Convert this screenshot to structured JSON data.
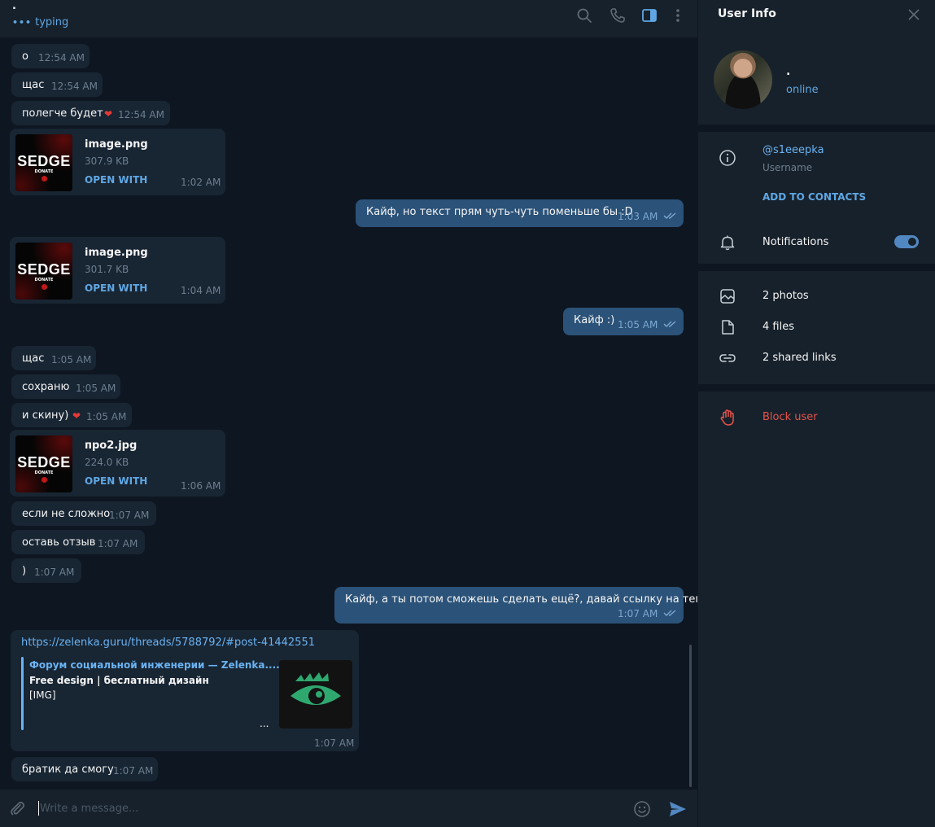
{
  "chat": {
    "peer_name": ".",
    "typing_text": "typing",
    "input_placeholder": "Write a message..."
  },
  "messages": [
    {
      "dir": "in",
      "text": "о",
      "time": "12:54 AM"
    },
    {
      "dir": "in",
      "text": "щас",
      "time": "12:54 AM"
    },
    {
      "dir": "in",
      "text": "полегче будет",
      "time": "12:54 AM",
      "reaction": "heart"
    },
    {
      "dir": "in",
      "type": "file",
      "thumb_brand": "SEDGE",
      "thumb_sub": "DONATE",
      "file_name": "image.png",
      "file_size": "307.9 KB",
      "action": "OPEN WITH",
      "time": "1:02 AM"
    },
    {
      "dir": "out",
      "text": "Кайф, но текст прям чуть-чуть поменьше бы :D",
      "time": "1:03 AM",
      "read": true
    },
    {
      "dir": "in",
      "type": "file",
      "thumb_brand": "SEDGE",
      "thumb_sub": "DONATE",
      "file_name": "image.png",
      "file_size": "301.7 KB",
      "action": "OPEN WITH",
      "time": "1:04 AM"
    },
    {
      "dir": "out",
      "text": "Кайф :)",
      "time": "1:05 AM",
      "read": true
    },
    {
      "dir": "in",
      "text": "щас",
      "time": "1:05 AM"
    },
    {
      "dir": "in",
      "text": "сохраню",
      "time": "1:05 AM"
    },
    {
      "dir": "in",
      "text": "и скину)",
      "time": "1:05 AM",
      "reaction": "heart"
    },
    {
      "dir": "in",
      "type": "file",
      "thumb_brand": "SEDGE",
      "thumb_sub": "DONATE",
      "file_name": "про2.jpg",
      "file_size": "224.0 KB",
      "action": "OPEN WITH",
      "time": "1:06 AM"
    },
    {
      "dir": "in",
      "text": "если не сложно",
      "time": "1:07 AM"
    },
    {
      "dir": "in",
      "text": "оставь отзыв",
      "time": "1:07 AM"
    },
    {
      "dir": "in",
      "text": ")",
      "time": "1:07 AM"
    },
    {
      "dir": "out",
      "text": "Кайф, а ты потом сможешь сделать ещё?, давай ссылку на тему.",
      "time": "1:07 AM",
      "read": true
    },
    {
      "dir": "in",
      "type": "link",
      "url": "https://zelenka.guru/threads/5788792/#post-41442551",
      "site": "Форум социальной инженерии — Zelenka....",
      "title": "Free design | беслатный дизайн",
      "desc": "[IMG]",
      "more": "...",
      "time": "1:07 AM"
    },
    {
      "dir": "in",
      "text": "братик да смогу",
      "time": "1:07 AM"
    }
  ],
  "info": {
    "title": "User Info",
    "name": ".",
    "status": "online",
    "username": "@s1eeepka",
    "username_label": "Username",
    "add_contacts": "ADD TO CONTACTS",
    "notifications_label": "Notifications",
    "notifications_on": true,
    "photos": "2 photos",
    "files": "4 files",
    "links": "2 shared links",
    "block": "Block user"
  },
  "colors": {
    "chat_bg": "#0e1621",
    "panel_bg": "#17212b",
    "incoming_bubble": "#182533",
    "outgoing_bubble": "#2b5278",
    "accent": "#5fa7e3",
    "danger": "#e5534b"
  },
  "icons": [
    "search-icon",
    "phone-icon",
    "sidebar-toggle-icon",
    "more-icon",
    "attach-icon",
    "emoji-icon",
    "send-icon",
    "close-icon",
    "info-icon",
    "bell-icon",
    "photo-icon",
    "file-icon",
    "link-icon",
    "hand-icon",
    "heart-icon",
    "double-check-icon"
  ]
}
